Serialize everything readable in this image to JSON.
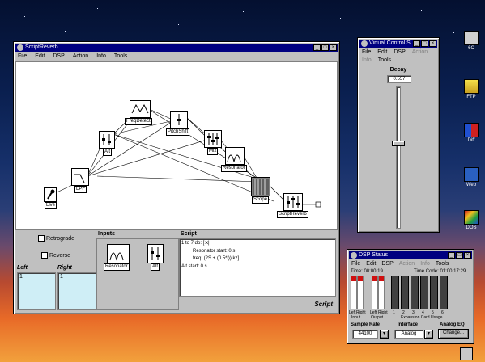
{
  "script_window": {
    "title": "ScriptReverb",
    "menu": [
      "File",
      "Edit",
      "DSP",
      "Action",
      "Info",
      "Tools"
    ],
    "modules": [
      {
        "id": "live",
        "label": "Live"
      },
      {
        "id": "lpf",
        "label": "LPF"
      },
      {
        "id": "alt",
        "label": "Alt"
      },
      {
        "id": "freqdetect",
        "label": "FreqDetect"
      },
      {
        "id": "pitchshift",
        "label": "PitchShift"
      },
      {
        "id": "mix",
        "label": "Mix"
      },
      {
        "id": "resonator",
        "label": "Resonator"
      },
      {
        "id": "scope",
        "label": "Scope"
      },
      {
        "id": "scriptreverb",
        "label": "ScriptReverb"
      }
    ],
    "retrograde_label": "Retrograde",
    "reverse_label": "Reverse",
    "left_label": "Left",
    "right_label": "Right",
    "left_value": "1",
    "right_value": "1",
    "inputs_label": "Inputs",
    "inputs": [
      {
        "label": "Resonator"
      },
      {
        "label": "Alt"
      }
    ],
    "script_label": "Script",
    "script_lines": [
      "1 to 7 do: [:x|",
      "Resonator start: 0 s",
      "freq: (2S + (0.5*i)) kz]",
      "Alt start: 0 s."
    ],
    "footer_label": "Script"
  },
  "vcs_window": {
    "title": "Virtual Control S...",
    "menu_row1": [
      "File",
      "Edit",
      "DSP",
      "Action"
    ],
    "menu_row2": [
      "Info",
      "Tools"
    ],
    "control_label": "Decay",
    "control_value": "0.557",
    "slider_level": 0.6
  },
  "dsp_window": {
    "title": "DSP Status",
    "menu": [
      "File",
      "Edit",
      "DSP",
      "Action",
      "Info",
      "Tools"
    ],
    "time_label": "Time: 00:00:19",
    "timecode_label": "Time Code: 01:00:17:29",
    "meters_left_labels": [
      "Left",
      "Right",
      "Left",
      "Right"
    ],
    "meters_group_labels": [
      "Input",
      "Output"
    ],
    "expansion_labels": [
      "1",
      "2",
      "3",
      "4",
      "5",
      "6"
    ],
    "expansion_group_label": "Expansion Card Usage",
    "sample_rate_label": "Sample Rate",
    "sample_rate_value": "44100",
    "interface_label": "Interface",
    "interface_value": "Analog",
    "analog_eq_label": "Analog EQ",
    "change_label": "Change..."
  },
  "desktop_icons": [
    {
      "label": "6C"
    },
    {
      "label": "FTP"
    },
    {
      "label": "Diff"
    },
    {
      "label": "Web"
    },
    {
      "label": "DOS"
    }
  ],
  "colors": {
    "titlebar": "#000080",
    "chrome": "#c0c0c0",
    "field": "#cfeef6"
  }
}
